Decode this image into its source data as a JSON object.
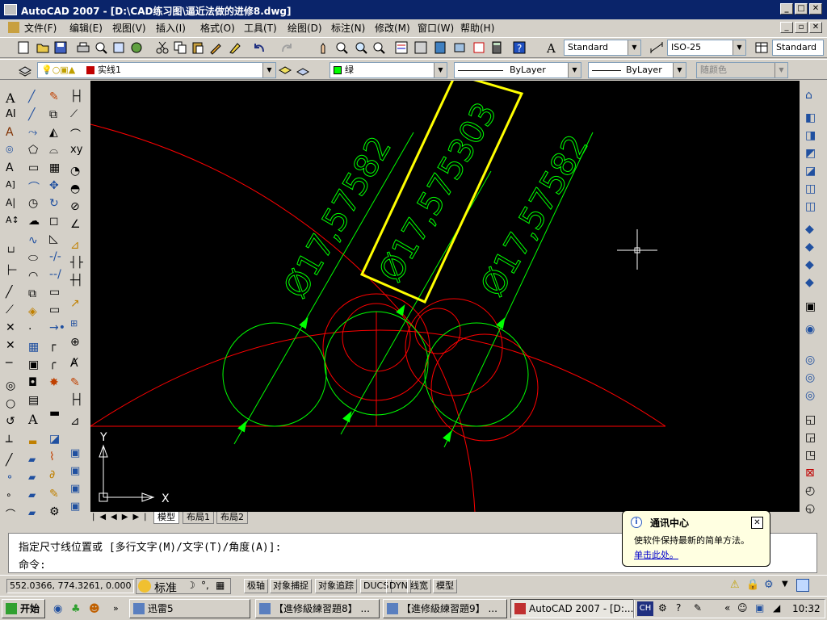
{
  "window": {
    "title": "AutoCAD 2007 - [D:\\CAD练习图\\逼近法做的进修8.dwg]"
  },
  "menu": [
    "文件(F)",
    "编辑(E)",
    "视图(V)",
    "插入(I)",
    "格式(O)",
    "工具(T)",
    "绘图(D)",
    "标注(N)",
    "修改(M)",
    "窗口(W)",
    "帮助(H)"
  ],
  "styles": {
    "text_style": "Standard",
    "dim_style": "ISO-25",
    "table_style": "Standard"
  },
  "layers": {
    "current_layer": "实线1",
    "color": "绿",
    "linetype": "ByLayer",
    "lineweight": "ByLayer",
    "plot_style": "随颜色"
  },
  "drawing": {
    "dim_left": "Ø17,57582",
    "dim_center": "Ø17,575303",
    "dim_right": "Ø17,57582",
    "ucs_x": "X",
    "ucs_y": "Y",
    "colors": {
      "background": "#000000",
      "arc": "#ff0000",
      "dimension": "#00ff00",
      "highlight": "#ffff00"
    }
  },
  "layout_tabs": [
    "模型",
    "布局1",
    "布局2"
  ],
  "command": {
    "prompt_line": "指定尺寸线位置或 [多行文字(M)/文字(T)/角度(A)]:",
    "input_line": "命令:"
  },
  "status": {
    "coordinates": "552.0366, 774.3261, 0.000",
    "ime_label": "标准",
    "toggles": [
      "极轴",
      "对象捕捉",
      "对象追踪",
      "DUCS",
      "DYN",
      "线宽",
      "模型"
    ]
  },
  "notification": {
    "title": "通讯中心",
    "body": "使软件保持最新的简单方法。",
    "link": "单击此处。"
  },
  "taskbar": {
    "start": "开始",
    "items": [
      "迅雷5",
      "【進修級練習題8】 ...",
      "【進修級練習題9】 ...",
      "AutoCAD 2007 - [D:..."
    ],
    "lang": "CH",
    "time": "10:32"
  }
}
